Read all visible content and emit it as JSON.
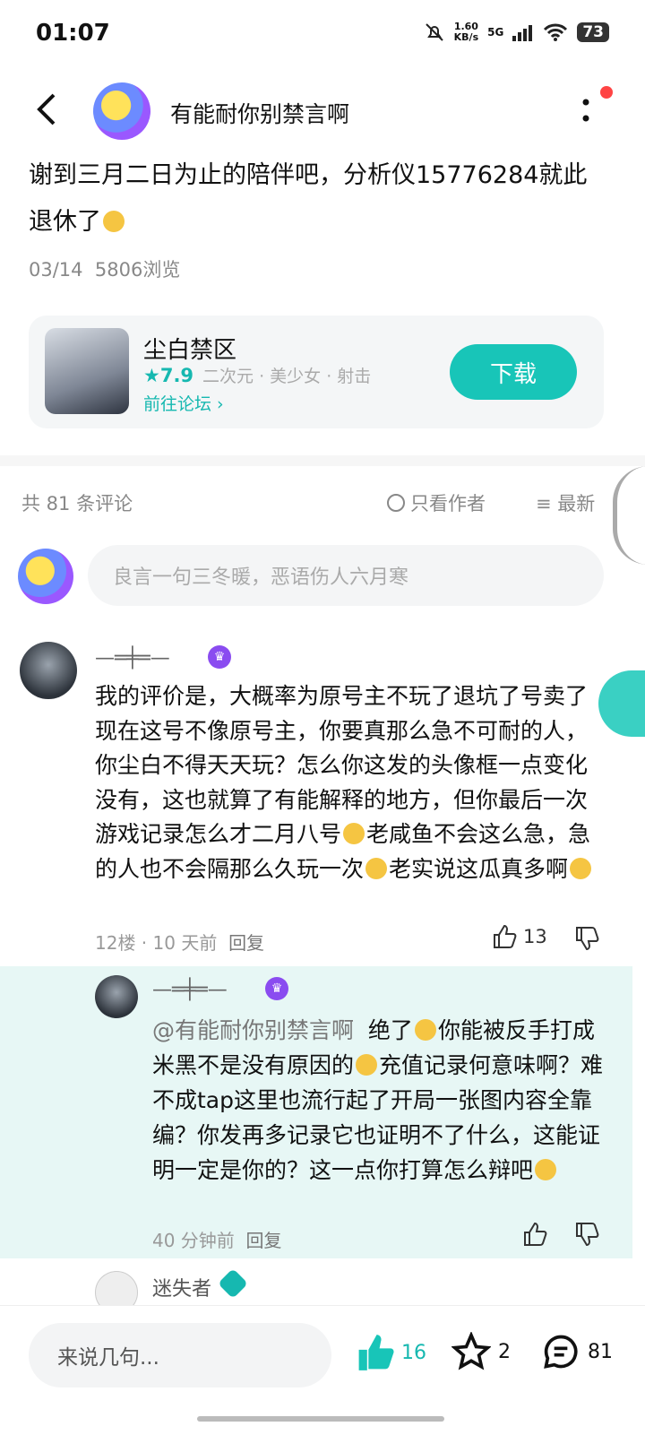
{
  "status_bar": {
    "time": "01:07",
    "speed_value": "1.60",
    "speed_unit": "KB/s",
    "network": "5G",
    "battery": "73"
  },
  "header": {
    "author": "有能耐你别禁言啊"
  },
  "post": {
    "text": "谢到三月二日为止的陪伴吧，分析仪15776284就此退休了",
    "date": "03/14",
    "views": "5806浏览"
  },
  "game_card": {
    "name": "尘白禁区",
    "rating": "7.9",
    "tags": "二次元 · 美少女 · 射击",
    "forum_link": "前往论坛",
    "download_label": "下载"
  },
  "comments_header": {
    "count": "共 81 条评论",
    "only_author": "只看作者",
    "sort": "最新"
  },
  "comment_input": {
    "placeholder": "良言一句三冬暖，恶语伤人六月寒"
  },
  "comment1": {
    "name": "—═╪═—",
    "text": "我的评价是，大概率为原号主不玩了退坑了号卖了现在这号不像原号主，你要真那么急不可耐的人，你尘白不得天天玩？怎么你这发的头像框一点变化没有，这也就算了有能解释的地方，但你最后一次游戏记录怎么才二月八号",
    "text2": "老咸鱼不会这么急，急的人也不会隔那么久玩一次",
    "text3": "老实说这瓜真多啊",
    "floor": "12楼",
    "time": "10 天前",
    "reply": "回复",
    "likes": "13"
  },
  "reply1": {
    "name": "—═╪═—",
    "mention": "@有能耐你别禁言啊",
    "text_a": "绝了",
    "text_b": "你能被反手打成米黑不是没有原因的",
    "text_c": "充值记录何意味啊？难不成tap这里也流行起了开局一张图内容全靠编？你发再多记录它也证明不了什么，这能证明一定是你的？这一点你打算怎么辩吧",
    "time": "40 分钟前",
    "reply": "回复"
  },
  "comment2": {
    "name": "迷失者"
  },
  "bottom_bar": {
    "input_label": "来说几句...",
    "likes": "16",
    "stars": "2",
    "comments": "81"
  }
}
